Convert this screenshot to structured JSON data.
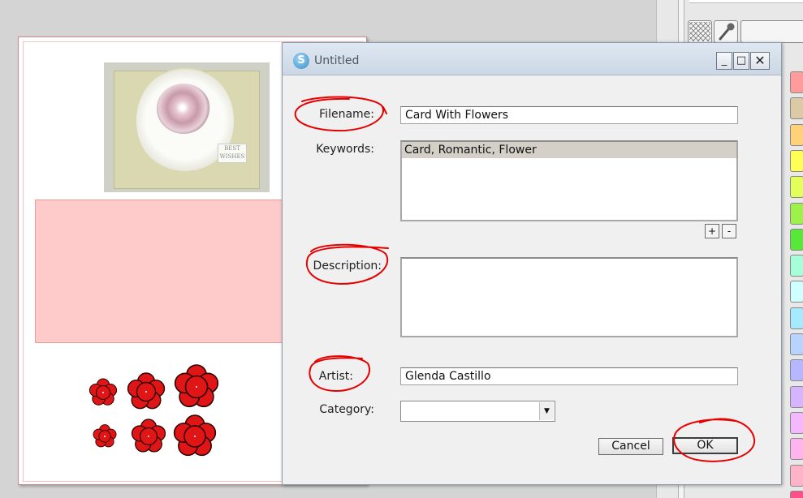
{
  "colors": {
    "annotation": "#e60000",
    "page_border": "#c98a8a",
    "pink_box": "#ffcaca",
    "flower_red": "#e01515",
    "keyword_highlight": "#d4d0c8"
  },
  "dialog": {
    "title": "Untitled",
    "window_buttons": {
      "minimize": "_",
      "maximize": "□",
      "close": "✕"
    },
    "filename_label": "Filename:",
    "filename_value": "Card With Flowers",
    "keywords_label": "Keywords:",
    "keywords": [
      "Card, Romantic, Flower"
    ],
    "add_keyword": "+",
    "remove_keyword": "-",
    "description_label": "Description:",
    "description_value": "",
    "artist_label": "Artist:",
    "artist_value": "Glenda Castillo",
    "category_label": "Category:",
    "category_value": "",
    "cancel_label": "Cancel",
    "ok_label": "OK"
  },
  "canvas": {
    "photo_tag_text": "BEST WISHES"
  },
  "palette": {
    "swatch_colors": [
      "#ff9b9b",
      "#dcc9a6",
      "#ffd27a",
      "#ffff55",
      "#e3ff5a",
      "#9ef04a",
      "#58e83a",
      "#a6ffd8",
      "#cfffff",
      "#a5eaff",
      "#b9d3ff",
      "#b7b7ff",
      "#d6b4ff",
      "#f4b8ff",
      "#ffb3ef",
      "#ffb3c8",
      "#ff4f8a"
    ],
    "tool_icons": [
      "transparent-pattern-icon",
      "eyedropper-icon"
    ]
  }
}
